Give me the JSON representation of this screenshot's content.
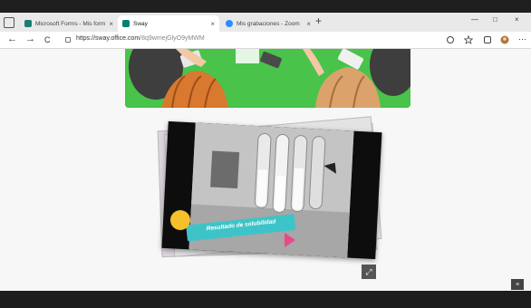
{
  "tabs": [
    {
      "title": "Microsoft Forms - Mis formula",
      "active": false,
      "favicon_color": "#1a7f6f"
    },
    {
      "title": "Sway",
      "active": true,
      "favicon_color": "#008272"
    },
    {
      "title": "Mis grabaciones - Zoom",
      "active": false,
      "favicon_color": "#2d8cff"
    }
  ],
  "icons": {
    "new_tab": "+",
    "close": "×",
    "back": "←",
    "forward": "→",
    "refresh": "C",
    "expand": "⤢"
  },
  "window": {
    "minimize": "—",
    "maximize": "□",
    "close": "×"
  },
  "address": {
    "host": "https://sway.office.com",
    "path": "/8q9wmejGlyO9yMWM"
  },
  "slide": {
    "caption": "Resultado de solubilidad"
  },
  "colors": {
    "accent_banner": "#3ec4c8",
    "yellow_dot": "#f6c02a",
    "pink": "#e74a8a",
    "hero_green": "#49c34a"
  }
}
